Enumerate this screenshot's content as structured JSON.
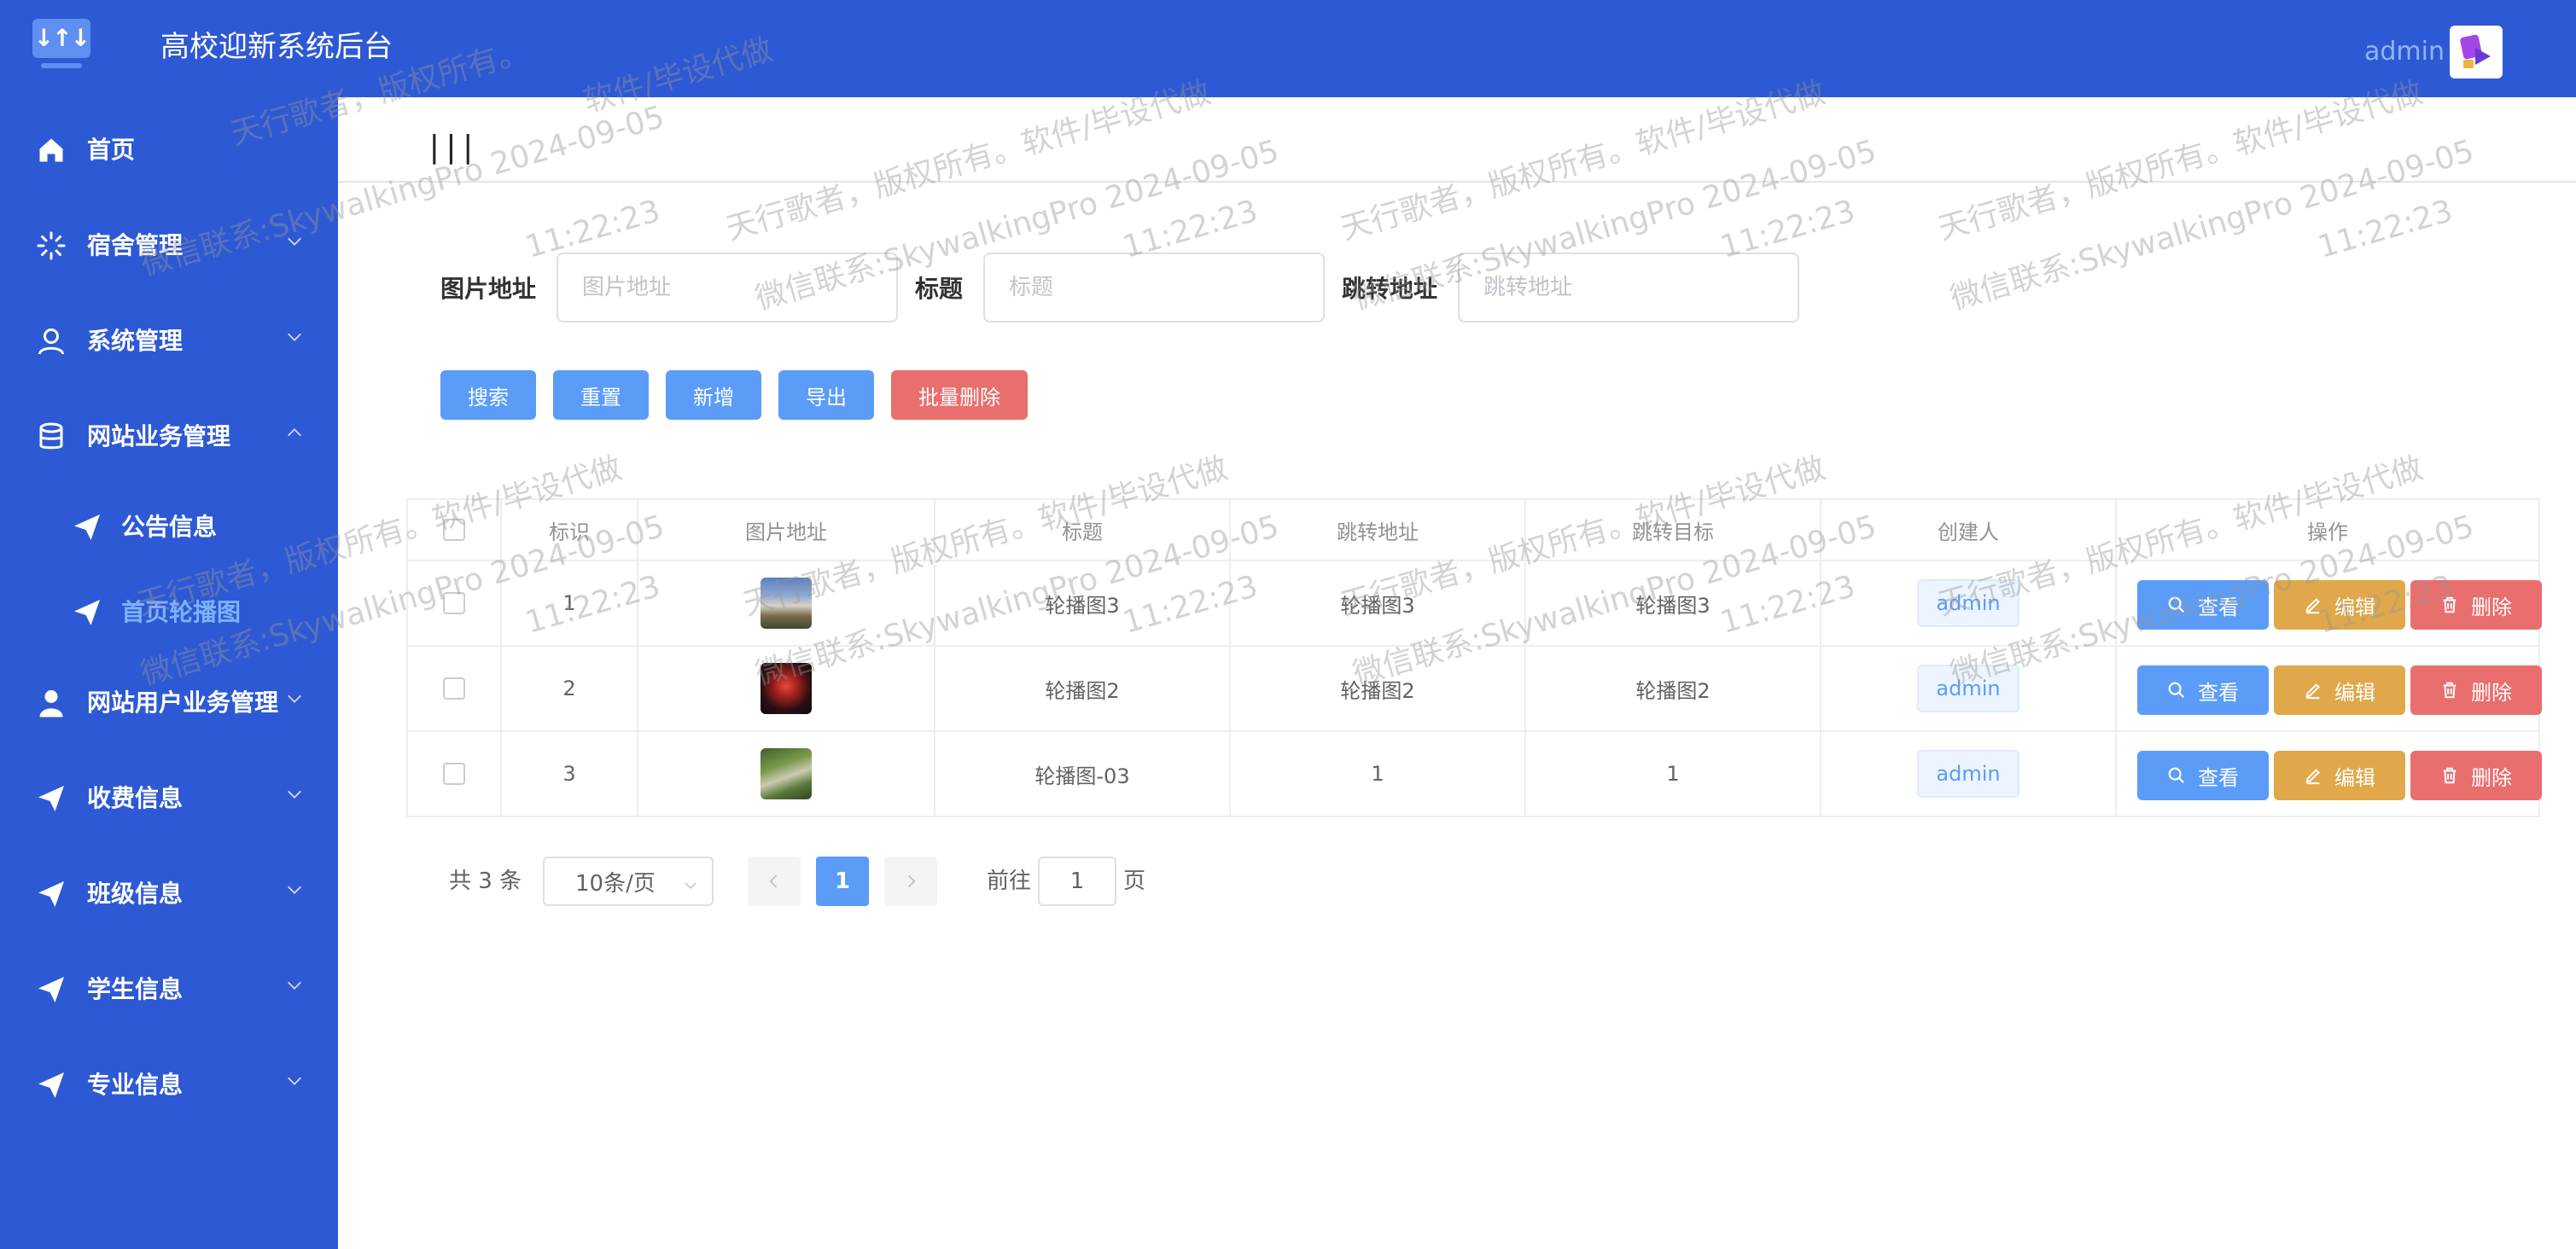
{
  "header": {
    "app_title": "高校迎新系统后台",
    "user_name": "admin",
    "logo_icon": "monitor-logo-icon",
    "brand_color": "#2e59d4"
  },
  "sidebar": {
    "items": [
      {
        "label": "首页",
        "icon": "home-icon"
      },
      {
        "label": "宿舍管理",
        "icon": "loading-icon"
      },
      {
        "label": "系统管理",
        "icon": "user-outline-icon"
      },
      {
        "label": "网站业务管理",
        "icon": "database-icon"
      },
      {
        "label": "公告信息",
        "icon": "send-icon"
      },
      {
        "label": "首页轮播图",
        "icon": "send-icon",
        "active": true
      },
      {
        "label": "网站用户业务管理",
        "icon": "user-icon"
      },
      {
        "label": "收费信息",
        "icon": "send-icon"
      },
      {
        "label": "班级信息",
        "icon": "send-icon"
      },
      {
        "label": "学生信息",
        "icon": "send-icon"
      },
      {
        "label": "专业信息",
        "icon": "send-icon"
      }
    ]
  },
  "toolbar": {
    "menu_toggle": "|||"
  },
  "search": {
    "image_label": "图片地址",
    "image_placeholder": "图片地址",
    "title_label": "标题",
    "title_placeholder": "标题",
    "link_label": "跳转地址",
    "link_placeholder": "跳转地址"
  },
  "actions": {
    "search": "搜索",
    "reset": "重置",
    "add": "新增",
    "export": "导出",
    "batch_delete": "批量删除"
  },
  "table": {
    "columns": [
      "标识",
      "图片地址",
      "标题",
      "跳转地址",
      "跳转目标",
      "创建人",
      "操作"
    ],
    "rows": [
      {
        "id": "1",
        "title": "轮播图3",
        "link": "轮播图3",
        "target": "轮播图3",
        "creator": "admin"
      },
      {
        "id": "2",
        "title": "轮播图2",
        "link": "轮播图2",
        "target": "轮播图2",
        "creator": "admin"
      },
      {
        "id": "3",
        "title": "轮播图-03",
        "link": "1",
        "target": "1",
        "creator": "admin"
      }
    ],
    "row_actions": {
      "view": "查看",
      "edit": "编辑",
      "delete": "删除"
    }
  },
  "pagination": {
    "total_text": "共 3 条",
    "page_size": "10条/页",
    "current_page": "1",
    "goto_label": "前往",
    "goto_value": "1",
    "page_unit": "页"
  },
  "watermark": {
    "line1": "软件/毕设代做",
    "line2": "天行歌者，版权所有。软件/毕设代做",
    "line3": "天行歌者，版权所有。软件/毕设代做",
    "text_a": "天行歌者，版权所有。",
    "text_b": "微信联系:SkywalkingPro 2024-09-05",
    "text_c": "11:22:23"
  }
}
